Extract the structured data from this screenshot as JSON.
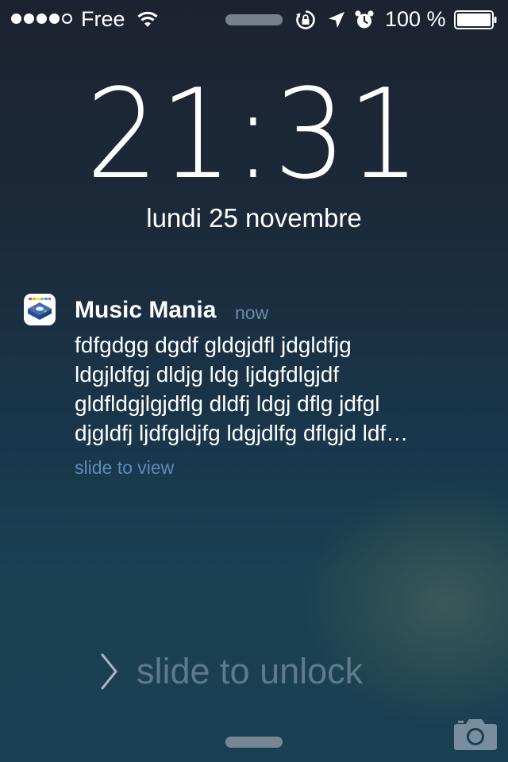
{
  "status_bar": {
    "signal_bars_filled": 4,
    "signal_bars_total": 5,
    "carrier": "Free",
    "battery_percent": "100 %",
    "icons": [
      "wifi-icon",
      "rotation-lock-icon",
      "location-arrow-icon",
      "alarm-clock-icon",
      "battery-icon"
    ]
  },
  "lock_screen": {
    "time": "21:31",
    "date": "lundi 25 novembre"
  },
  "notification": {
    "app_name": "Music Mania",
    "timestamp": "now",
    "message": "fdfgdgg dgdf gldgjdfl jdgldfjg\nldgjldfgj dldjg ldg ljdgfdlgjdf\ngldfldgjlgjdflg dldfj ldgj dflg jdfgl\ndjgldfj ljdfgldjfg ldgjdlfg dflgjd ldf…",
    "action": "slide to view"
  },
  "bottom": {
    "unlock_label": "slide to unlock",
    "icons": [
      "chevron-right-icon",
      "camera-icon"
    ]
  },
  "colors": {
    "accent_link": "#5d8ab8",
    "timestamp": "#6f8aa8",
    "background_top": "#1c2330",
    "background_bottom": "#1b3f52"
  }
}
